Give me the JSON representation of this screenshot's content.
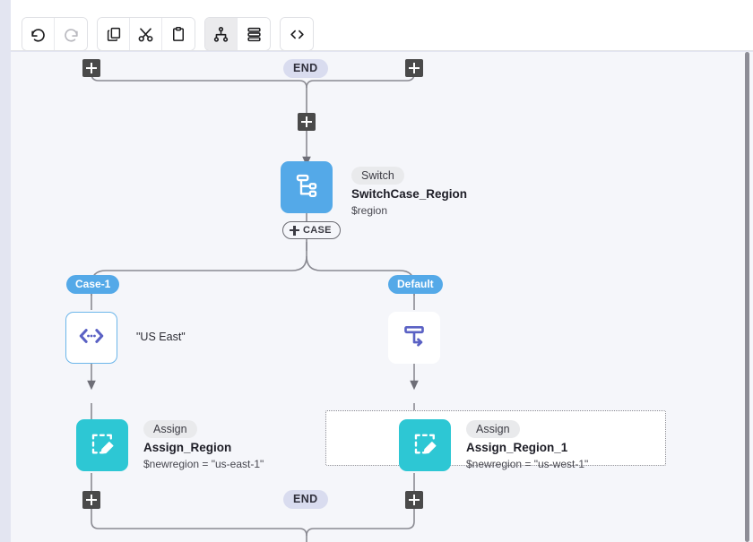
{
  "toolbar": {
    "groups": [
      {
        "name": "history",
        "buttons": [
          {
            "icon": "undo-icon",
            "label": "Undo",
            "state": "enabled"
          },
          {
            "icon": "redo-icon",
            "label": "Redo",
            "state": "disabled"
          }
        ]
      },
      {
        "name": "clipboard",
        "buttons": [
          {
            "icon": "copy-icon",
            "label": "Copy",
            "state": "enabled"
          },
          {
            "icon": "cut-icon",
            "label": "Cut",
            "state": "enabled"
          },
          {
            "icon": "paste-icon",
            "label": "Paste",
            "state": "enabled"
          }
        ]
      },
      {
        "name": "layout",
        "buttons": [
          {
            "icon": "tree-layout-icon",
            "label": "Tree layout",
            "state": "active"
          },
          {
            "icon": "stack-layout-icon",
            "label": "Stacked layout",
            "state": "enabled"
          }
        ]
      },
      {
        "name": "code",
        "buttons": [
          {
            "icon": "code-icon",
            "label": "Code view",
            "state": "enabled"
          }
        ]
      }
    ]
  },
  "canvas": {
    "background_color": "#f5f6fa",
    "end_badges": [
      {
        "label": "END",
        "position": "top"
      },
      {
        "label": "END",
        "position": "bottom"
      }
    ],
    "case_add_button": {
      "label": "CASE",
      "icon": "plus-icon"
    },
    "branch_badges": [
      {
        "label": "Case-1",
        "color": "#54a9e8"
      },
      {
        "label": "Default",
        "color": "#54a9e8"
      }
    ],
    "nodes": [
      {
        "id": "switch",
        "type": "Switch",
        "name": "SwitchCase_Region",
        "subtitle": "$region",
        "icon": "switch-branch-icon",
        "color": "#54a9e8"
      },
      {
        "id": "case-1-condition",
        "icon": "condition-code-icon",
        "color": "#5a61c4",
        "inline_text": "\"US East\""
      },
      {
        "id": "default-condition",
        "icon": "default-branch-icon",
        "color": "#5a61c4"
      },
      {
        "id": "assign-region",
        "type": "Assign",
        "name": "Assign_Region",
        "subtitle": "$newregion = \"us-east-1\"",
        "icon": "assign-edit-icon",
        "color": "#2dc7d4"
      },
      {
        "id": "assign-region-1",
        "type": "Assign",
        "name": "Assign_Region_1",
        "subtitle": "$newregion = \"us-west-1\"",
        "icon": "assign-edit-icon",
        "color": "#2dc7d4",
        "selected": true
      }
    ],
    "add_buttons": [
      {
        "id": "add-top-left",
        "icon": "plus-icon"
      },
      {
        "id": "add-top-right",
        "icon": "plus-icon"
      },
      {
        "id": "add-before-switch",
        "icon": "plus-icon"
      },
      {
        "id": "add-case-1",
        "icon": "plus-icon"
      },
      {
        "id": "add-default",
        "icon": "plus-icon"
      },
      {
        "id": "add-bottom-left",
        "icon": "plus-icon"
      },
      {
        "id": "add-bottom-right",
        "icon": "plus-icon"
      }
    ]
  },
  "scrollbar": {
    "orientation": "vertical"
  }
}
